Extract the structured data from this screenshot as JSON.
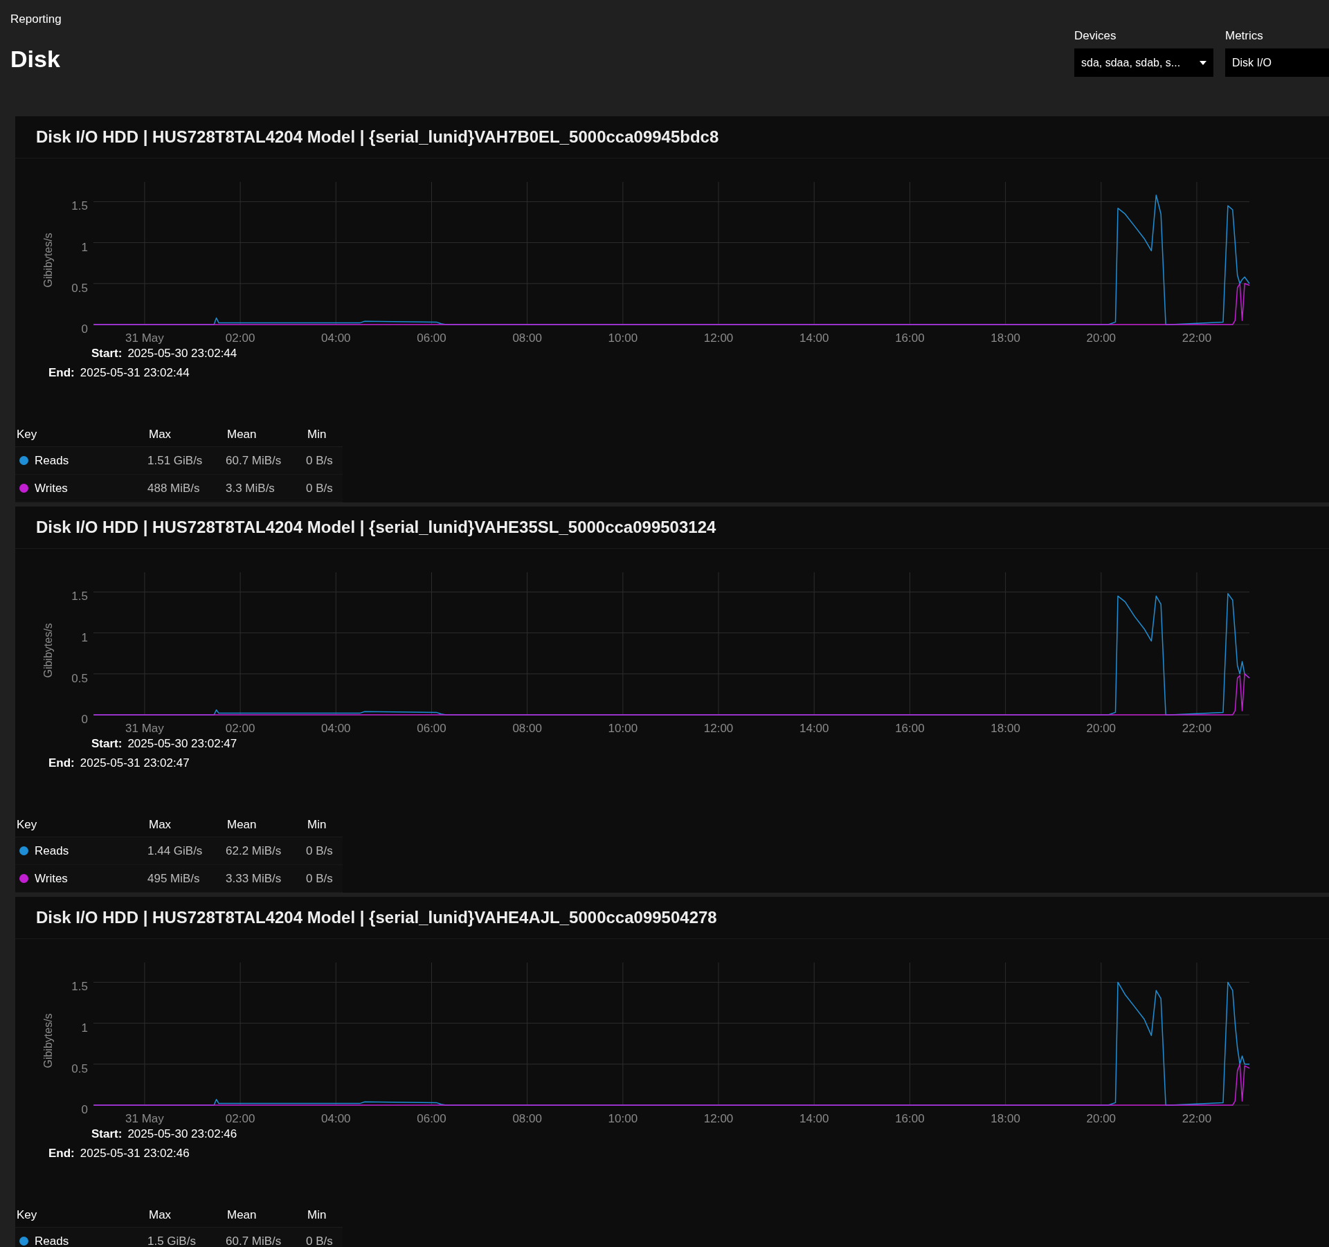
{
  "header": {
    "breadcrumb": "Reporting",
    "title": "Disk"
  },
  "filters": [
    {
      "label": "Devices",
      "value": "sda, sdaa, sdab, s...",
      "kind": "dropdown"
    },
    {
      "label": "Metrics",
      "value": "Disk I/O",
      "kind": "field"
    }
  ],
  "cards": [
    {
      "title": "Disk I/O HDD | HUS728T8TAL4204 Model | {serial_lunid}VAH7B0EL_5000cca09945bdc8",
      "chart_data": {
        "type": "line",
        "ylabel": "Gibibytes/s",
        "grid": true,
        "xlim": [
          -1.07,
          23.1
        ],
        "ylim": [
          0,
          1.74
        ],
        "xticks": [
          {
            "value": 0,
            "label": "31 May"
          },
          {
            "value": 2,
            "label": "02:00"
          },
          {
            "value": 4,
            "label": "04:00"
          },
          {
            "value": 6,
            "label": "06:00"
          },
          {
            "value": 8,
            "label": "08:00"
          },
          {
            "value": 10,
            "label": "10:00"
          },
          {
            "value": 12,
            "label": "12:00"
          },
          {
            "value": 14,
            "label": "14:00"
          },
          {
            "value": 16,
            "label": "16:00"
          },
          {
            "value": 18,
            "label": "18:00"
          },
          {
            "value": 20,
            "label": "20:00"
          },
          {
            "value": 22,
            "label": "22:00"
          }
        ],
        "yticks": [
          {
            "value": 0,
            "label": "0"
          },
          {
            "value": 0.5,
            "label": "0.5"
          },
          {
            "value": 1,
            "label": "1"
          },
          {
            "value": 1.5,
            "label": "1.5"
          }
        ],
        "x": [
          -1.07,
          1.45,
          1.5,
          1.55,
          3,
          4.5,
          4.6,
          6.1,
          6.2,
          6.3,
          20.15,
          20.3,
          20.35,
          20.5,
          20.7,
          20.9,
          21.05,
          21.15,
          21.25,
          21.35,
          21.45,
          22.55,
          22.65,
          22.75,
          22.8,
          22.85,
          22.9,
          22.95,
          23,
          23.1
        ],
        "series": [
          {
            "name": "Reads",
            "color": "#1e8fd6",
            "values": [
              0,
              0,
              0.08,
              0.02,
              0.02,
              0.02,
              0.04,
              0.03,
              0.01,
              0,
              0,
              0.03,
              1.42,
              1.35,
              1.2,
              1.05,
              0.9,
              1.58,
              1.35,
              0,
              0,
              0.03,
              1.45,
              1.4,
              1.0,
              0.6,
              0.5,
              0.55,
              0.58,
              0.5
            ]
          },
          {
            "name": "Writes",
            "color": "#c21ed2",
            "values": [
              0,
              0,
              0,
              0,
              0,
              0,
              0,
              0,
              0,
              0,
              0,
              0,
              0,
              0,
              0,
              0,
              0,
              0,
              0,
              0,
              0,
              0,
              0,
              0,
              0.05,
              0.45,
              0.5,
              0.05,
              0.5,
              0.48
            ]
          }
        ]
      },
      "range": [
        {
          "label": "Start:",
          "value": "2025-05-30 23:02:44"
        },
        {
          "label": "End:",
          "value": "2025-05-31 23:02:44"
        }
      ],
      "legend": {
        "columns": [
          "Key",
          "Max",
          "Mean",
          "Min"
        ],
        "rows": [
          {
            "max": "1.51 GiB/s",
            "mean": "60.7 MiB/s",
            "min": "0 B/s"
          },
          {
            "max": "488 MiB/s",
            "mean": "3.3 MiB/s",
            "min": "0 B/s"
          }
        ]
      }
    },
    {
      "title": "Disk I/O HDD | HUS728T8TAL4204 Model | {serial_lunid}VAHE35SL_5000cca099503124",
      "chart_data": {
        "type": "line",
        "ylabel": "Gibibytes/s",
        "grid": true,
        "xlim": [
          -1.07,
          23.1
        ],
        "ylim": [
          0,
          1.74
        ],
        "xticks": [
          {
            "value": 0,
            "label": "31 May"
          },
          {
            "value": 2,
            "label": "02:00"
          },
          {
            "value": 4,
            "label": "04:00"
          },
          {
            "value": 6,
            "label": "06:00"
          },
          {
            "value": 8,
            "label": "08:00"
          },
          {
            "value": 10,
            "label": "10:00"
          },
          {
            "value": 12,
            "label": "12:00"
          },
          {
            "value": 14,
            "label": "14:00"
          },
          {
            "value": 16,
            "label": "16:00"
          },
          {
            "value": 18,
            "label": "18:00"
          },
          {
            "value": 20,
            "label": "20:00"
          },
          {
            "value": 22,
            "label": "22:00"
          }
        ],
        "yticks": [
          {
            "value": 0,
            "label": "0"
          },
          {
            "value": 0.5,
            "label": "0.5"
          },
          {
            "value": 1,
            "label": "1"
          },
          {
            "value": 1.5,
            "label": "1.5"
          }
        ],
        "x": [
          -1.07,
          1.45,
          1.5,
          1.55,
          3,
          4.5,
          4.6,
          6.1,
          6.2,
          6.3,
          20.15,
          20.3,
          20.35,
          20.5,
          20.7,
          20.9,
          21.05,
          21.15,
          21.25,
          21.35,
          21.45,
          22.55,
          22.65,
          22.75,
          22.8,
          22.85,
          22.9,
          22.95,
          23,
          23.1
        ],
        "series": [
          {
            "name": "Reads",
            "color": "#1e8fd6",
            "values": [
              0,
              0,
              0.06,
              0.02,
              0.02,
              0.02,
              0.04,
              0.03,
              0.01,
              0,
              0,
              0.03,
              1.45,
              1.38,
              1.2,
              1.05,
              0.9,
              1.45,
              1.35,
              0,
              0,
              0.03,
              1.48,
              1.4,
              1.0,
              0.6,
              0.5,
              0.65,
              0.5,
              0.45
            ]
          },
          {
            "name": "Writes",
            "color": "#c21ed2",
            "values": [
              0,
              0,
              0,
              0,
              0,
              0,
              0,
              0,
              0,
              0,
              0,
              0,
              0,
              0,
              0,
              0,
              0,
              0,
              0,
              0,
              0,
              0,
              0,
              0,
              0.05,
              0.45,
              0.48,
              0.05,
              0.5,
              0.45
            ]
          }
        ]
      },
      "range": [
        {
          "label": "Start:",
          "value": "2025-05-30 23:02:47"
        },
        {
          "label": "End:",
          "value": "2025-05-31 23:02:47"
        }
      ],
      "legend": {
        "columns": [
          "Key",
          "Max",
          "Mean",
          "Min"
        ],
        "rows": [
          {
            "max": "1.44 GiB/s",
            "mean": "62.2 MiB/s",
            "min": "0 B/s"
          },
          {
            "max": "495 MiB/s",
            "mean": "3.33 MiB/s",
            "min": "0 B/s"
          }
        ]
      }
    },
    {
      "title": "Disk I/O HDD | HUS728T8TAL4204 Model | {serial_lunid}VAHE4AJL_5000cca099504278",
      "chart_data": {
        "type": "line",
        "ylabel": "Gibibytes/s",
        "grid": true,
        "xlim": [
          -1.07,
          23.1
        ],
        "ylim": [
          0,
          1.74
        ],
        "xticks": [
          {
            "value": 0,
            "label": "31 May"
          },
          {
            "value": 2,
            "label": "02:00"
          },
          {
            "value": 4,
            "label": "04:00"
          },
          {
            "value": 6,
            "label": "06:00"
          },
          {
            "value": 8,
            "label": "08:00"
          },
          {
            "value": 10,
            "label": "10:00"
          },
          {
            "value": 12,
            "label": "12:00"
          },
          {
            "value": 14,
            "label": "14:00"
          },
          {
            "value": 16,
            "label": "16:00"
          },
          {
            "value": 18,
            "label": "18:00"
          },
          {
            "value": 20,
            "label": "20:00"
          },
          {
            "value": 22,
            "label": "22:00"
          }
        ],
        "yticks": [
          {
            "value": 0,
            "label": "0"
          },
          {
            "value": 0.5,
            "label": "0.5"
          },
          {
            "value": 1,
            "label": "1"
          },
          {
            "value": 1.5,
            "label": "1.5"
          }
        ],
        "x": [
          -1.07,
          1.45,
          1.5,
          1.55,
          3,
          4.5,
          4.6,
          6.1,
          6.2,
          6.3,
          20.15,
          20.3,
          20.35,
          20.5,
          20.7,
          20.9,
          21.05,
          21.15,
          21.25,
          21.35,
          21.45,
          22.55,
          22.65,
          22.75,
          22.8,
          22.85,
          22.9,
          22.95,
          23,
          23.1
        ],
        "series": [
          {
            "name": "Reads",
            "color": "#1e8fd6",
            "values": [
              0,
              0,
              0.07,
              0.02,
              0.02,
              0.02,
              0.04,
              0.03,
              0.01,
              0,
              0,
              0.03,
              1.5,
              1.35,
              1.2,
              1.05,
              0.85,
              1.4,
              1.3,
              0,
              0,
              0.03,
              1.5,
              1.4,
              1.0,
              0.7,
              0.5,
              0.6,
              0.5,
              0.5
            ]
          },
          {
            "color": "#c21ed2",
            "values": [
              0,
              0,
              0,
              0,
              0,
              0,
              0,
              0,
              0,
              0,
              0,
              0,
              0,
              0,
              0,
              0,
              0,
              0,
              0,
              0,
              0,
              0,
              0,
              0,
              0.05,
              0.42,
              0.5,
              0.05,
              0.48,
              0.45
            ]
          }
        ]
      },
      "range": [
        {
          "label": "Start:",
          "value": "2025-05-30 23:02:46"
        },
        {
          "label": "End:",
          "value": "2025-05-31 23:02:46"
        }
      ],
      "legend": {
        "columns": [
          "Key",
          "Max",
          "Mean",
          "Min"
        ],
        "rows": [
          {
            "max": "1.5 GiB/s",
            "mean": "60.7 MiB/s",
            "min": "0 B/s"
          }
        ]
      }
    }
  ]
}
